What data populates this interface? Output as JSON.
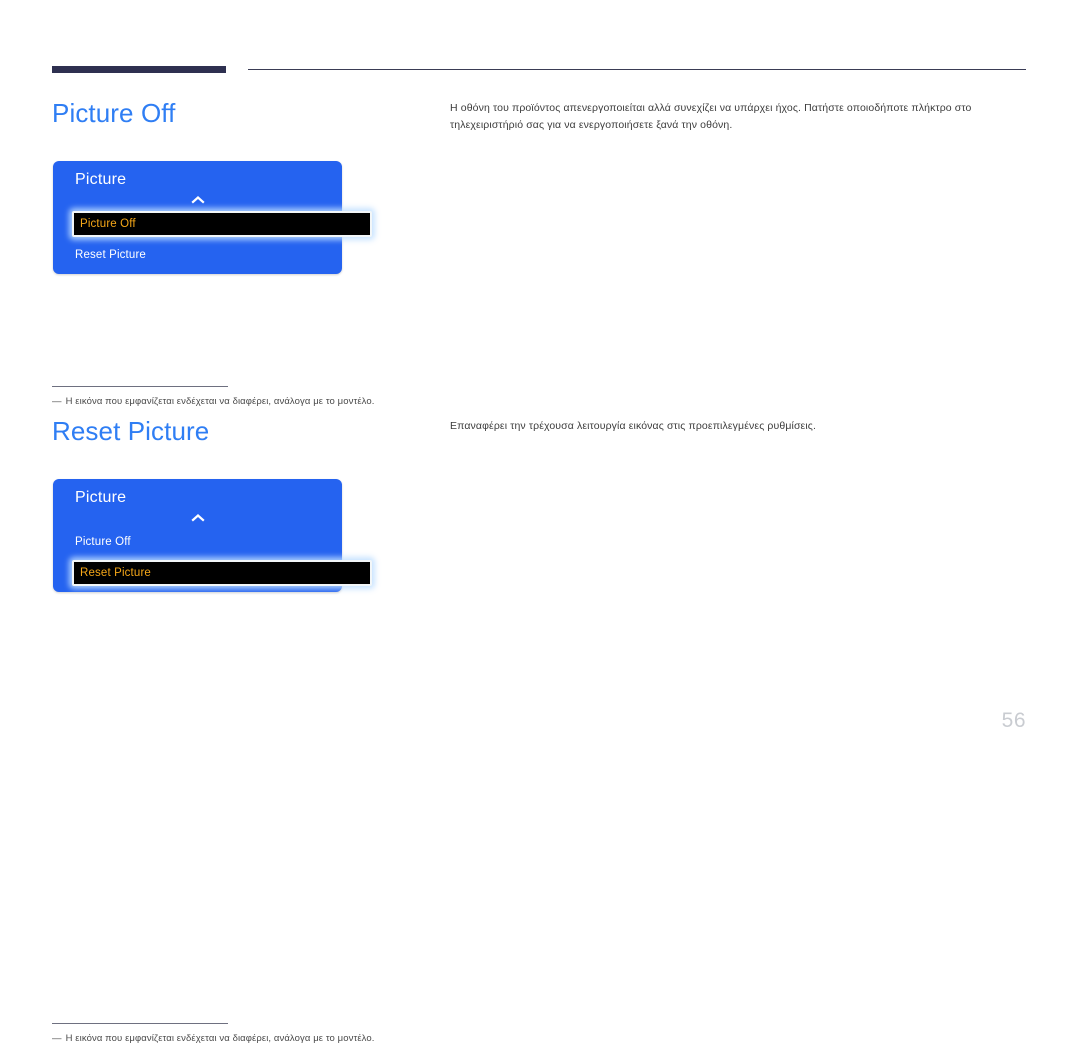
{
  "page": {
    "number": "56"
  },
  "header": {
    "rule_thick_color": "#2e3050",
    "rule_thin_color": "#3a3c55"
  },
  "theme": {
    "heading_color": "#2f7ef4",
    "osd_background": "#2563f0",
    "osd_selected_background": "#000000",
    "osd_selected_text": "#f5a718",
    "osd_selected_border": "#f2f6f8",
    "page_number_color": "#c9ccd1"
  },
  "sections": [
    {
      "id": "picture-off",
      "title": "Picture Off",
      "description": "Η οθόνη του προϊόντος απενεργοποιείται αλλά συνεχίζει να υπάρχει ήχος. Πατήστε οποιοδήποτε πλήκτρο στο τηλεχειριστήριό σας για να ενεργοποιήσετε ξανά την οθόνη.",
      "osd": {
        "title": "Picture",
        "scroll_indicator": "scroll-up-chevron-icon",
        "items": [
          {
            "label": "Picture Off",
            "selected": true
          },
          {
            "label": "Reset Picture",
            "selected": false
          }
        ]
      },
      "footnote": {
        "dash": "―",
        "text": "Η εικόνα που εμφανίζεται ενδέχεται να διαφέρει, ανάλογα με το μοντέλο."
      }
    },
    {
      "id": "reset-picture",
      "title": "Reset Picture",
      "description": "Επαναφέρει την τρέχουσα λειτουργία εικόνας στις προεπιλεγμένες ρυθμίσεις.",
      "osd": {
        "title": "Picture",
        "scroll_indicator": "scroll-up-chevron-icon",
        "items": [
          {
            "label": "Picture Off",
            "selected": false
          },
          {
            "label": "Reset Picture",
            "selected": true
          }
        ]
      },
      "footnote": {
        "dash": "―",
        "text": "Η εικόνα που εμφανίζεται ενδέχεται να διαφέρει, ανάλογα με το μοντέλο."
      }
    }
  ]
}
